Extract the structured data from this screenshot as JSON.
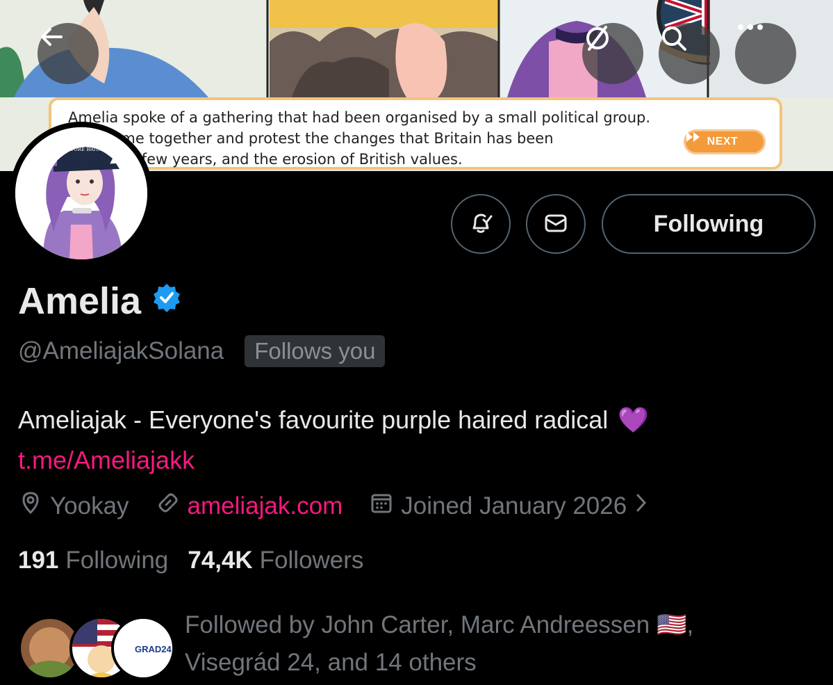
{
  "banner": {
    "caption": "Amelia spoke of a gathering that had been organised by a small political group.\n   ould come together and protest the changes that Britain has been\n   n the last few years, and the erosion of British values.",
    "next_label": "NEXT",
    "cap_text": "RESTORE BRITAIN"
  },
  "nav": {
    "back_icon": "arrow-left-icon",
    "grok_icon": "slash-circle-icon",
    "search_icon": "search-icon",
    "more_icon": "more-icon"
  },
  "actions": {
    "notify_icon": "bell-check-icon",
    "message_icon": "envelope-icon",
    "follow_label": "Following"
  },
  "profile": {
    "name": "Amelia",
    "handle": "@AmeliajakSolana",
    "follows_you": "Follows you",
    "bio": "Ameliajak - Everyone's favourite purple haired radical",
    "bio_emoji": "💜",
    "bio_link": "t.me/Ameliajakk",
    "location": "Yookay",
    "website": "ameliajak.com",
    "joined": "Joined January 2026",
    "following_count": "191",
    "following_label": "Following",
    "followers_count": "74,4K",
    "followers_label": "Followers",
    "followed_by_line1": "Followed by John Carter, Marc Andreessen 🇺🇸,",
    "followed_by_line2": "Visegrád 24, and 14 others",
    "grad_label": "GRAD24"
  },
  "colors": {
    "accent_link": "#f91880",
    "verified": "#1d9bf0",
    "muted": "#71767b"
  }
}
